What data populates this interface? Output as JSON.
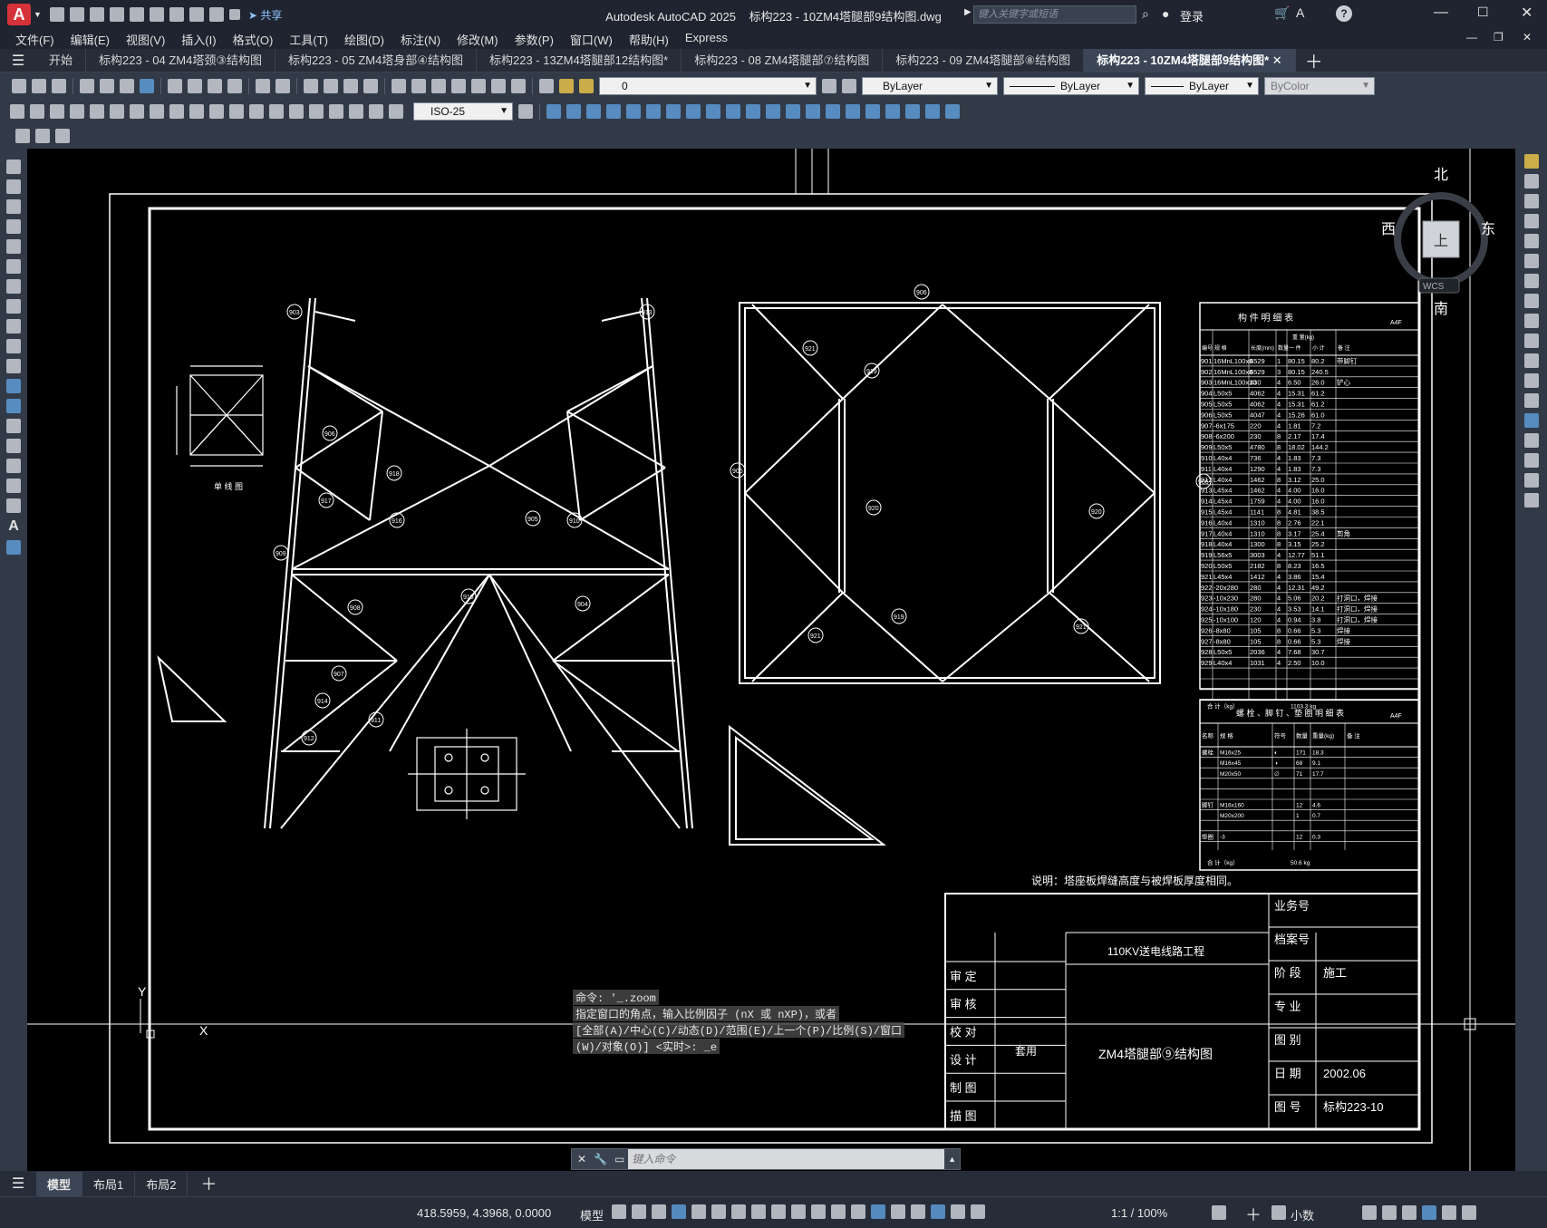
{
  "app": {
    "title": "Autodesk AutoCAD 2025",
    "document": "标构223 - 10ZM4塔腿部9结构图.dwg",
    "share_label": "共享",
    "search_placeholder": "键入关键字或短语",
    "login_label": "登录"
  },
  "menu": [
    "文件(F)",
    "编辑(E)",
    "视图(V)",
    "插入(I)",
    "格式(O)",
    "工具(T)",
    "绘图(D)",
    "标注(N)",
    "修改(M)",
    "参数(P)",
    "窗口(W)",
    "帮助(H)",
    "Express"
  ],
  "tabs": [
    {
      "label": "开始"
    },
    {
      "label": "标构223 - 04 ZM4塔颈③结构图"
    },
    {
      "label": "标构223 - 05 ZM4塔身部④结构图"
    },
    {
      "label": "标构223 - 13ZM4塔腿部12结构图*"
    },
    {
      "label": "标构223 - 08 ZM4塔腿部⑦结构图"
    },
    {
      "label": "标构223 - 09 ZM4塔腿部⑧结构图"
    },
    {
      "label": "标构223 - 10ZM4塔腿部9结构图*",
      "active": true
    }
  ],
  "toolbar": {
    "layer_value": "0",
    "color_value": "ByLayer",
    "linetype_value": "ByLayer",
    "lineweight_value": "ByLayer",
    "plotstyle_value": "ByColor",
    "dimstyle_value": "ISO-25"
  },
  "viewcube": {
    "north": "北",
    "south": "南",
    "east": "东",
    "west": "西",
    "top": "上",
    "wcs": "WCS"
  },
  "drawing": {
    "parts_table_title": "构 件 明 细 表",
    "bolts_table_title": "螺 栓 、脚 钉 、垫 圈 明 细 表",
    "sheet_tag": "A4F",
    "parts_columns": [
      "编号",
      "规 格",
      "长度(mm)",
      "数量",
      "一 件",
      "小 计",
      "备 注"
    ],
    "parts_weight_header": "重 量(kg)",
    "parts_rows": [
      [
        "901",
        "16MnL100x8",
        "6529",
        "1",
        "80.15",
        "80.2",
        "带脚钉"
      ],
      [
        "902",
        "16MnL100x8",
        "6529",
        "3",
        "80.15",
        "240.5",
        ""
      ],
      [
        "903",
        "16MnL100x10",
        "430",
        "4",
        "6.50",
        "26.0",
        "铲心"
      ],
      [
        "904",
        "L50x5",
        "4062",
        "4",
        "15.31",
        "61.2",
        ""
      ],
      [
        "905",
        "L50x5",
        "4062",
        "4",
        "15.31",
        "61.2",
        ""
      ],
      [
        "906",
        "L50x5",
        "4047",
        "4",
        "15.26",
        "61.0",
        ""
      ],
      [
        "907",
        "-6x175",
        "220",
        "4",
        "1.81",
        "7.2",
        ""
      ],
      [
        "908",
        "-6x200",
        "230",
        "8",
        "2.17",
        "17.4",
        ""
      ],
      [
        "909",
        "L50x5",
        "4780",
        "8",
        "18.02",
        "144.2",
        ""
      ],
      [
        "910",
        "L40x4",
        "736",
        "4",
        "1.83",
        "7.3",
        ""
      ],
      [
        "911",
        "L40x4",
        "1290",
        "4",
        "1.83",
        "7.3",
        ""
      ],
      [
        "912",
        "L40x4",
        "1462",
        "8",
        "3.12",
        "25.0",
        ""
      ],
      [
        "913",
        "L45x4",
        "1462",
        "4",
        "4.00",
        "16.0",
        ""
      ],
      [
        "914",
        "L45x4",
        "1759",
        "4",
        "4.00",
        "16.0",
        ""
      ],
      [
        "915",
        "L45x4",
        "1141",
        "8",
        "4.81",
        "38.5",
        ""
      ],
      [
        "916",
        "L40x4",
        "1310",
        "8",
        "2.76",
        "22.1",
        ""
      ],
      [
        "917",
        "L40x4",
        "1310",
        "8",
        "3.17",
        "25.4",
        "剪角"
      ],
      [
        "918",
        "L40x4",
        "1300",
        "8",
        "3.15",
        "25.2",
        ""
      ],
      [
        "919",
        "L56x5",
        "3003",
        "4",
        "12.77",
        "51.1",
        ""
      ],
      [
        "920",
        "L50x5",
        "2182",
        "8",
        "8.23",
        "16.5",
        ""
      ],
      [
        "921",
        "L45x4",
        "1412",
        "4",
        "3.86",
        "15.4",
        ""
      ],
      [
        "922",
        "-20x280",
        "280",
        "4",
        "12.31",
        "49.2",
        ""
      ],
      [
        "923",
        "-10x230",
        "280",
        "4",
        "5.06",
        "20.2",
        "打洞口，焊接"
      ],
      [
        "924",
        "-10x180",
        "230",
        "4",
        "3.53",
        "14.1",
        "打洞口，焊接"
      ],
      [
        "925",
        "-10x100",
        "120",
        "4",
        "0.94",
        "3.8",
        "打洞口，焊接"
      ],
      [
        "926",
        "-8x80",
        "105",
        "8",
        "0.66",
        "5.3",
        "焊接"
      ],
      [
        "927",
        "-8x80",
        "105",
        "8",
        "0.66",
        "5.3",
        "焊接"
      ],
      [
        "928",
        "L50x5",
        "2036",
        "4",
        "7.68",
        "30.7",
        ""
      ],
      [
        "929",
        "L40x4",
        "1031",
        "4",
        "2.50",
        "10.0",
        ""
      ]
    ],
    "parts_total_label": "合 计（kg）",
    "parts_total": "1103.3 kg",
    "bolts_columns": [
      "名称",
      "规 格",
      "符号",
      "数量",
      "重量(kg)",
      "备 注"
    ],
    "bolts_rows": [
      [
        "螺栓",
        "M16x25",
        "◐",
        "171",
        "18.3",
        ""
      ],
      [
        "",
        "M16x45",
        "◑",
        "68",
        "9.1",
        ""
      ],
      [
        "",
        "M20x50",
        "∅",
        "71",
        "17.7",
        ""
      ],
      [
        "",
        "",
        "",
        "",
        "",
        ""
      ],
      [
        "",
        "",
        "",
        "",
        "",
        ""
      ],
      [
        "脚钉",
        "M16x160",
        "",
        "12",
        "4.6",
        ""
      ],
      [
        "",
        "M20x200",
        "",
        "1",
        "0.7",
        ""
      ],
      [
        "",
        "",
        "",
        "",
        "",
        ""
      ],
      [
        "垫圈",
        "-3",
        "",
        "12",
        "0.3",
        ""
      ]
    ],
    "bolts_total_label": "合 计（kg）",
    "bolts_total": "50.6 kg",
    "note": "说明：塔座板焊缝高度与被焊板厚度相同。",
    "elevation_label": "单 线 图",
    "title_block": {
      "roles": [
        "审 定",
        "审 核",
        "校 对",
        "设 计",
        "制 图",
        "描 图"
      ],
      "designer": "套用",
      "project": "110KV送电线路工程",
      "drawing_name": "ZM4塔腿部⑨结构图",
      "fields": [
        {
          "label": "业务号",
          "value": ""
        },
        {
          "label": "档案号",
          "value": ""
        },
        {
          "label": "阶 段",
          "value": "施工"
        },
        {
          "label": "专 业",
          "value": ""
        },
        {
          "label": "图 别",
          "value": ""
        },
        {
          "label": "日 期",
          "value": "2002.06"
        },
        {
          "label": "图 号",
          "value": "标构223-10"
        }
      ]
    },
    "callouts": [
      "903",
      "906",
      "918",
      "917",
      "916",
      "909",
      "908",
      "915",
      "907",
      "914",
      "912",
      "911",
      "910",
      "905",
      "904",
      "913",
      "906",
      "919",
      "921",
      "920",
      "919",
      "921",
      "906",
      "920",
      "906",
      "921"
    ]
  },
  "command": {
    "history": [
      "命令: '_.zoom",
      "指定窗口的角点，输入比例因子 (nX 或 nXP)，或者",
      "[全部(A)/中心(C)/动态(D)/范围(E)/上一个(P)/比例(S)/窗口",
      "(W)/对象(O)] <实时>: _e"
    ],
    "placeholder": "键入命令"
  },
  "layouts": [
    "模型",
    "布局1",
    "布局2"
  ],
  "status": {
    "coords": "418.5959, 4.3968, 0.0000",
    "space": "模型",
    "annotation_scale": "1:1 / 100%",
    "units": "小数"
  },
  "colors": {
    "accent": "#5d9bd6",
    "canvas": "#000000",
    "chrome": "#2b3340",
    "active_tab": "#3b4556"
  }
}
